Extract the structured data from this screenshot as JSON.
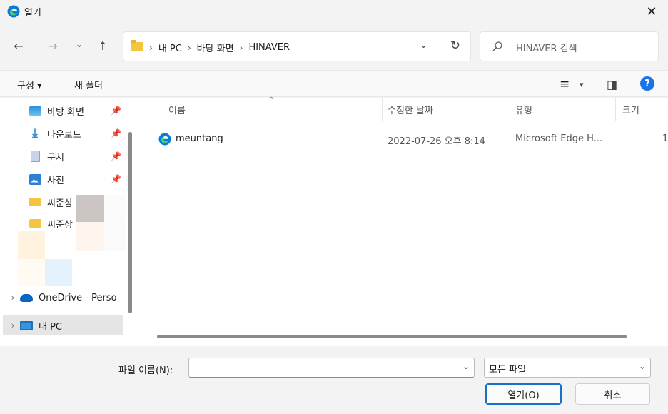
{
  "window": {
    "title": "열기",
    "close_glyph": "✕"
  },
  "nav": {
    "back_glyph": "←",
    "forward_glyph": "→",
    "recent_glyph": "⌄",
    "up_glyph": "↑",
    "breadcrumb": [
      "내 PC",
      "바탕 화면",
      "HINAVER"
    ],
    "breadcrumb_sep": "›",
    "dropdown_glyph": "⌄",
    "refresh_glyph": "↻",
    "search_placeholder": "HINAVER 검색"
  },
  "toolbar": {
    "organize_label": "구성 ▾",
    "new_folder_label": "새 폴더",
    "view_glyph": "≡",
    "view_dropdown_glyph": "▾",
    "pane_glyph": "◨",
    "help_glyph": "?"
  },
  "sidebar": {
    "items": [
      {
        "label": "바탕 화면",
        "icon": "desktop-icon",
        "pinned": true
      },
      {
        "label": "다운로드",
        "icon": "download-icon",
        "pinned": true
      },
      {
        "label": "문서",
        "icon": "document-icon",
        "pinned": true
      },
      {
        "label": "사진",
        "icon": "pictures-icon",
        "pinned": true
      },
      {
        "label": "씨준상",
        "icon": "folder-icon",
        "pinned": false
      },
      {
        "label": "씨준상",
        "icon": "folder-icon",
        "pinned": false
      },
      {
        "label": "OneDrive - Perso",
        "icon": "onedrive-icon",
        "expandable": true
      },
      {
        "label": "내 PC",
        "icon": "pc-icon",
        "expandable": true,
        "selected": true
      }
    ],
    "pin_glyph": "📌",
    "expand_glyph": "›"
  },
  "columns": {
    "name": "이름",
    "date": "수정한 날짜",
    "type": "유형",
    "size": "크기",
    "sort_glyph": "^"
  },
  "files": [
    {
      "name": "meuntang",
      "date": "2022-07-26 오후 8:14",
      "type": "Microsoft Edge H...",
      "size": "1"
    }
  ],
  "footer": {
    "filename_label": "파일 이름(N):",
    "filename_value": "",
    "filter_label": "모든 파일",
    "open_label": "열기(O)",
    "cancel_label": "취소",
    "caret_glyph": "⌄",
    "grip_glyph": "⋰"
  },
  "colors": {
    "accent": "#1a6fc9",
    "folder": "#f4c542",
    "help": "#1a73e8"
  }
}
